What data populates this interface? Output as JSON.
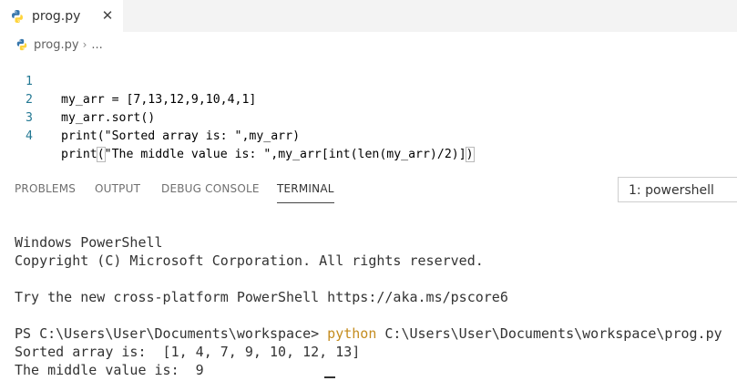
{
  "tab": {
    "label": "prog.py",
    "close_glyph": "✕"
  },
  "breadcrumb": {
    "file": "prog.py",
    "separator": "›",
    "more": "..."
  },
  "editor": {
    "lines": [
      {
        "number": "1",
        "code": "my_arr = [7,13,12,9,10,4,1]"
      },
      {
        "number": "2",
        "code": "my_arr.sort()"
      },
      {
        "number": "3",
        "code": "print(\"Sorted array is: \",my_arr)"
      },
      {
        "number": "4",
        "code_prefix": "print",
        "paren_open": "(",
        "code_mid": "\"The middle value is: \",my_arr[int(len(my_arr)/2)]",
        "paren_close": ")"
      }
    ]
  },
  "panel": {
    "tabs": [
      "PROBLEMS",
      "OUTPUT",
      "DEBUG CONSOLE",
      "TERMINAL"
    ],
    "active_tab": "TERMINAL",
    "shell": "1: powershell"
  },
  "terminal": {
    "l1": "Windows PowerShell",
    "l2": "Copyright (C) Microsoft Corporation. All rights reserved.",
    "l3": "Try the new cross-platform PowerShell https://aka.ms/pscore6",
    "prompt": "PS C:\\Users\\User\\Documents\\workspace> ",
    "command": "python",
    "command_arg": " C:\\Users\\User\\Documents\\workspace\\prog.py",
    "out1": "Sorted array is:  [1, 4, 7, 9, 10, 12, 13]",
    "out2": "The middle value is:  9"
  },
  "colors": {
    "command": "#c48c1f",
    "line_number": "#237893",
    "python_blue": "#3776ab",
    "python_yellow": "#ffd43b"
  },
  "icons": {
    "tab_icon": "python-icon",
    "breadcrumb_icon": "python-icon"
  }
}
